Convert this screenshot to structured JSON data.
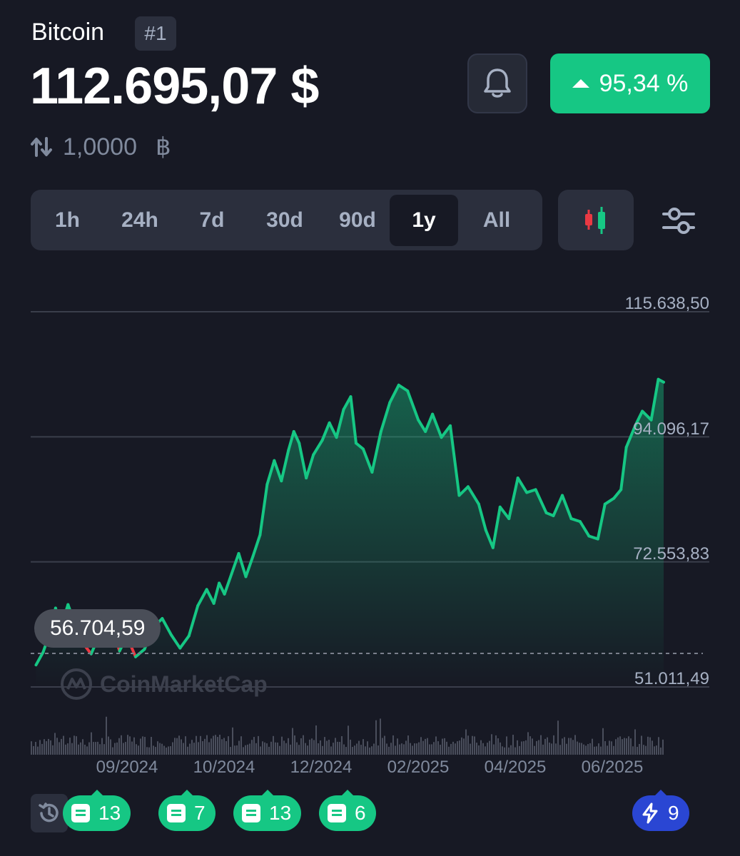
{
  "header": {
    "coin_name": "Bitcoin",
    "rank": "#1",
    "price": "112.695,07 $",
    "change_percent": "95,34 %",
    "change_direction": "up",
    "conversion_value": "1,0000",
    "conversion_unit": "฿"
  },
  "icons": {
    "bell": "bell-icon",
    "change_arrow": "triangle-up-icon",
    "swap": "swap-vertical-icon",
    "candles": "candlestick-icon",
    "settings": "sliders-icon",
    "history": "history-icon",
    "news": "note-icon",
    "lightning": "lightning-icon",
    "watermark": "coinmarketcap-logo"
  },
  "timeframes": [
    "1h",
    "24h",
    "7d",
    "30d",
    "90d",
    "1y",
    "All"
  ],
  "active_timeframe": "1y",
  "chart": {
    "y_labels": [
      "115.638,50",
      "94.096,17",
      "72.553,83",
      "51.011,49"
    ],
    "x_labels": [
      "09/2024",
      "10/2024",
      "12/2024",
      "02/2025",
      "04/2025",
      "06/2025"
    ],
    "low_label": "56.704,59",
    "watermark": "CoinMarketCap"
  },
  "chart_data": {
    "type": "area",
    "x": [
      "2024-07-25",
      "2024-07-29",
      "2024-08-02",
      "2024-08-05",
      "2024-08-08",
      "2024-08-12",
      "2024-08-16",
      "2024-08-20",
      "2024-08-25",
      "2024-08-29",
      "2024-09-02",
      "2024-09-06",
      "2024-09-10",
      "2024-09-14",
      "2024-09-19",
      "2024-09-24",
      "2024-09-29",
      "2024-10-04",
      "2024-10-09",
      "2024-10-14",
      "2024-10-19",
      "2024-10-24",
      "2024-10-29",
      "2024-11-02",
      "2024-11-05",
      "2024-11-08",
      "2024-11-12",
      "2024-11-16",
      "2024-11-20",
      "2024-11-24",
      "2024-11-28",
      "2024-12-02",
      "2024-12-06",
      "2024-12-10",
      "2024-12-14",
      "2024-12-17",
      "2024-12-20",
      "2024-12-24",
      "2024-12-28",
      "2025-01-02",
      "2025-01-06",
      "2025-01-10",
      "2025-01-14",
      "2025-01-18",
      "2025-01-21",
      "2025-01-25",
      "2025-01-30",
      "2025-02-04",
      "2025-02-09",
      "2025-02-14",
      "2025-02-19",
      "2025-02-25",
      "2025-03-01",
      "2025-03-05",
      "2025-03-10",
      "2025-03-15",
      "2025-03-20",
      "2025-03-25",
      "2025-03-31",
      "2025-04-04",
      "2025-04-08",
      "2025-04-12",
      "2025-04-17",
      "2025-04-22",
      "2025-04-27",
      "2025-05-02",
      "2025-05-08",
      "2025-05-12",
      "2025-05-17",
      "2025-05-22",
      "2025-05-27",
      "2025-06-01",
      "2025-06-06",
      "2025-06-10",
      "2025-06-15",
      "2025-06-19",
      "2025-06-22",
      "2025-06-27",
      "2025-07-01",
      "2025-07-06",
      "2025-07-10",
      "2025-07-13"
    ],
    "series": [
      {
        "values": [
          54800,
          57000,
          60500,
          64600,
          61200,
          65200,
          61800,
          58700,
          56700,
          59500,
          60000,
          61200,
          57200,
          59800,
          56200,
          57500,
          61300,
          62800,
          60000,
          57700,
          59800,
          65000,
          67800,
          65400,
          68900,
          67000,
          70500,
          74000,
          70000,
          73500,
          77200,
          85900,
          90000,
          86500,
          91800,
          95000,
          93000,
          87000,
          91000,
          93500,
          96500,
          94000,
          98800,
          101000,
          93000,
          92000,
          88000,
          95000,
          100000,
          103000,
          102000,
          97000,
          95000,
          98000,
          94000,
          96000,
          84000,
          85500,
          82500,
          78000,
          75000,
          82000,
          80000,
          87000,
          84500,
          85000,
          81000,
          80500,
          84000,
          80000,
          79500,
          77000,
          76500,
          82500,
          83500,
          85000,
          92300,
          96000,
          98500,
          97000,
          104000,
          103500
        ]
      }
    ],
    "ylim": [
      51011.49,
      115638.5
    ],
    "yticks": [
      115638.5,
      94096.17,
      72553.83,
      51011.49
    ],
    "low": 56704.59,
    "grid": true,
    "line_color": "#16c784",
    "down_color": "#ea3943"
  },
  "footer": {
    "pills": [
      {
        "label": "13",
        "type": "news"
      },
      {
        "label": "7",
        "type": "news"
      },
      {
        "label": "13",
        "type": "news"
      },
      {
        "label": "6",
        "type": "news"
      },
      {
        "label": "9",
        "type": "flash"
      }
    ]
  },
  "colors": {
    "background": "#171924",
    "accent_green": "#16c784",
    "accent_red": "#ea3943",
    "accent_blue": "#2a46d3",
    "panel": "#2b2f3d",
    "muted_text": "#a6b0c3"
  }
}
